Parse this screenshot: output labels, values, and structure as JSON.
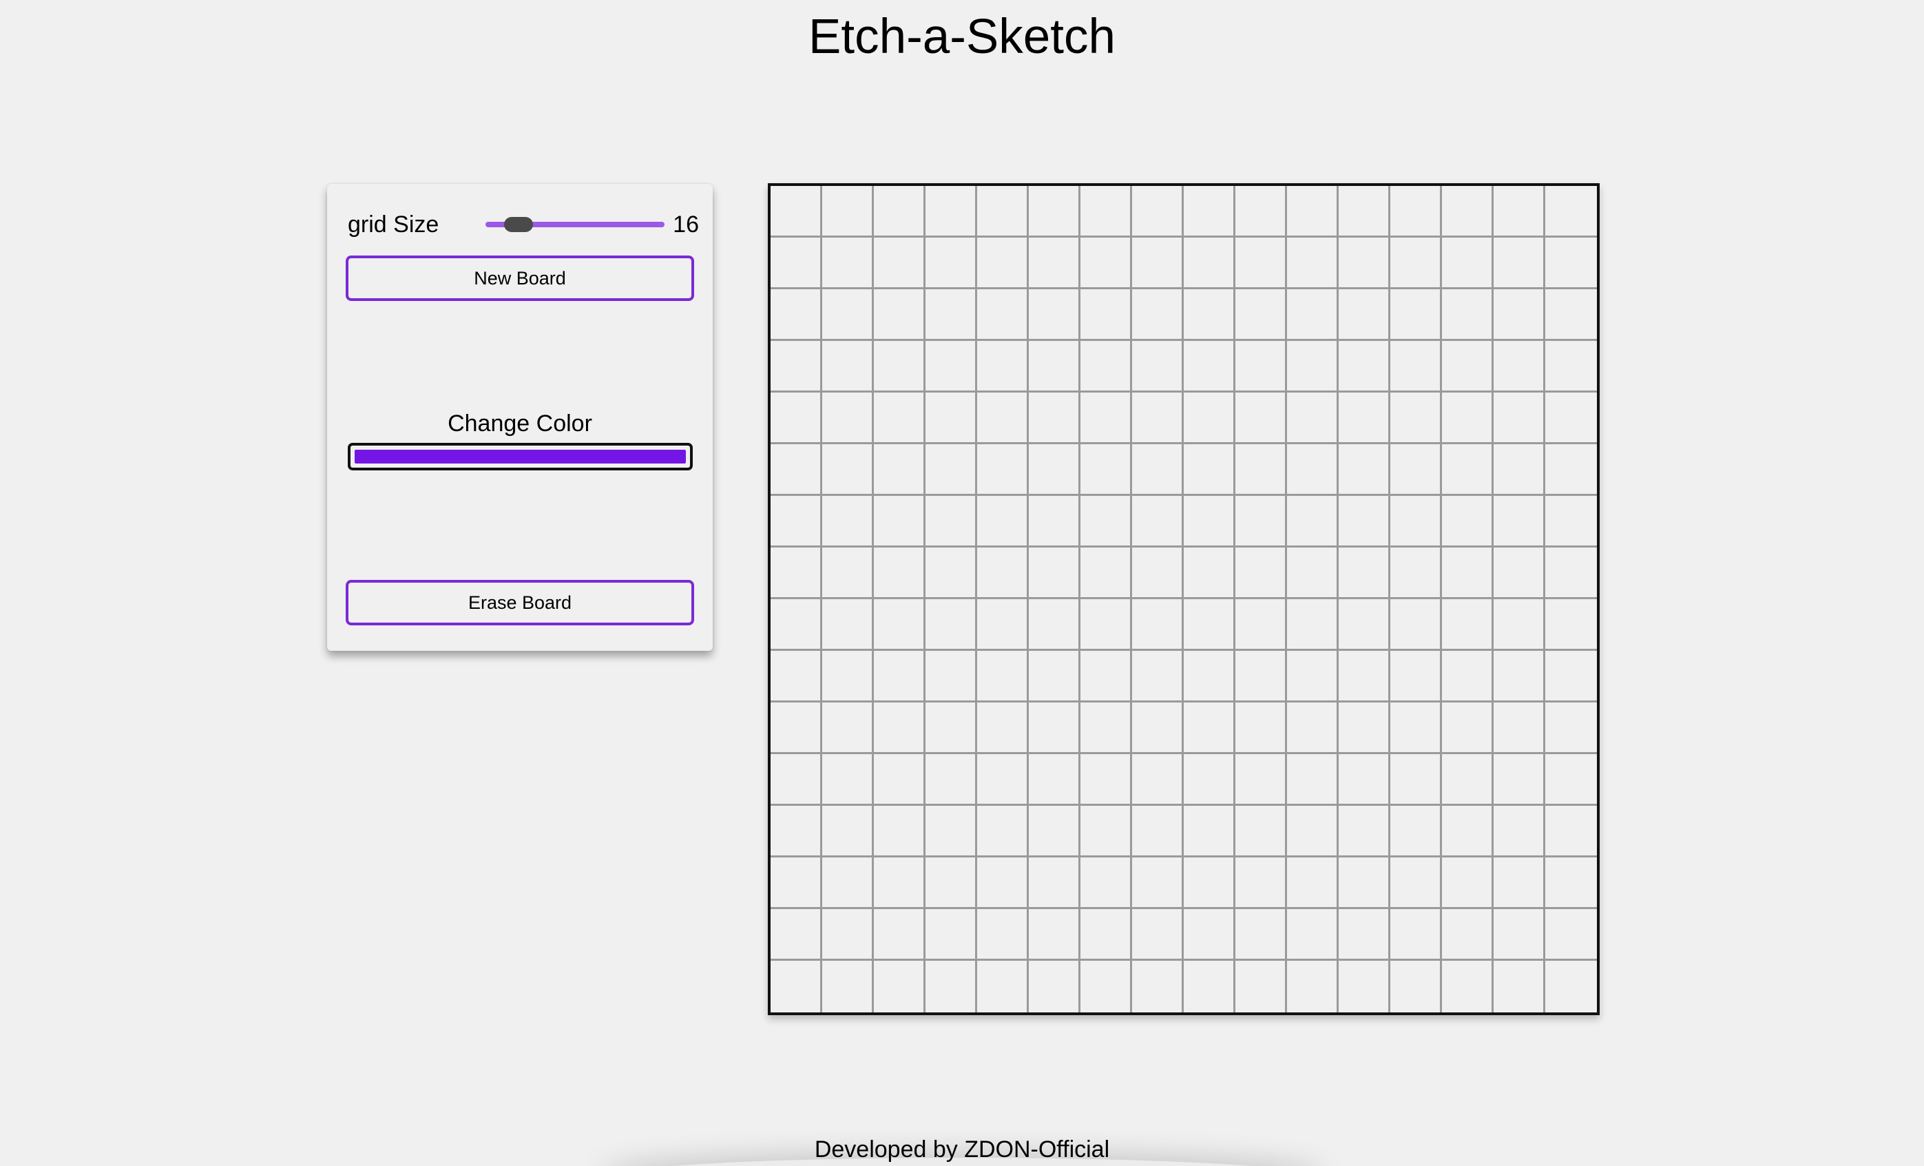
{
  "page": {
    "title": "Etch-a-Sketch"
  },
  "controls": {
    "grid_size_label": "grid Size",
    "grid_size_value": "16",
    "grid_size_slider": {
      "min": 2,
      "max": 100,
      "value": 16
    },
    "new_board_label": "New Board",
    "change_color_label": "Change Color",
    "selected_color": "#7316e5",
    "erase_board_label": "Erase Board"
  },
  "board": {
    "grid_size": 16,
    "line_color": "#9a9a9a",
    "background_color": "#f0f0f0"
  },
  "footer": {
    "text": "Developed by ZDON-Official"
  },
  "colors": {
    "accent": "#7a2ad6",
    "slider_track": "#9b59e6",
    "slider_thumb": "#4a4a4a",
    "page_background": "#f0f0f0"
  }
}
